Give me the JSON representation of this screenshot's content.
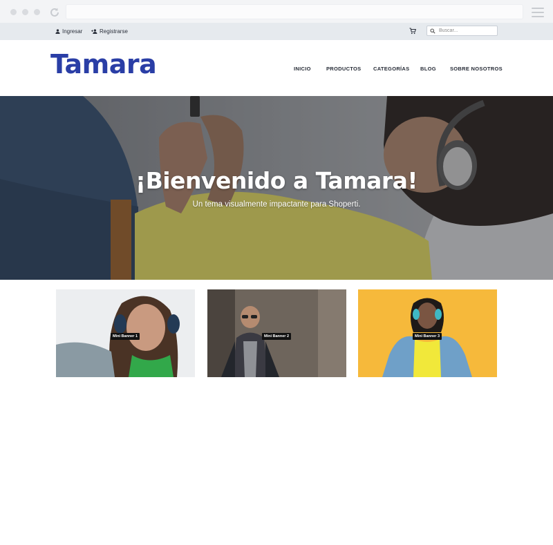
{
  "topbar": {
    "login_label": "Ingresar",
    "register_label": "Registrarse",
    "search_placeholder": "Buscar..."
  },
  "header": {
    "logo": "Tamara",
    "nav": [
      "INICIO",
      "PRODUCTOS",
      "CATEGORÍAS",
      "BLOG",
      "SOBRE NOSOTROS"
    ]
  },
  "hero": {
    "title": "¡Bienvenido a Tamara!",
    "subtitle": "Un tema visualmente impactante para Shoperti."
  },
  "banners": [
    "Mini Banner 1",
    "Mini Banner 2",
    "Mini Banner 3"
  ],
  "colors": {
    "brand": "#2a3ea6",
    "topbar_bg": "#e6eaee",
    "banner3_bg": "#f6b93b"
  }
}
